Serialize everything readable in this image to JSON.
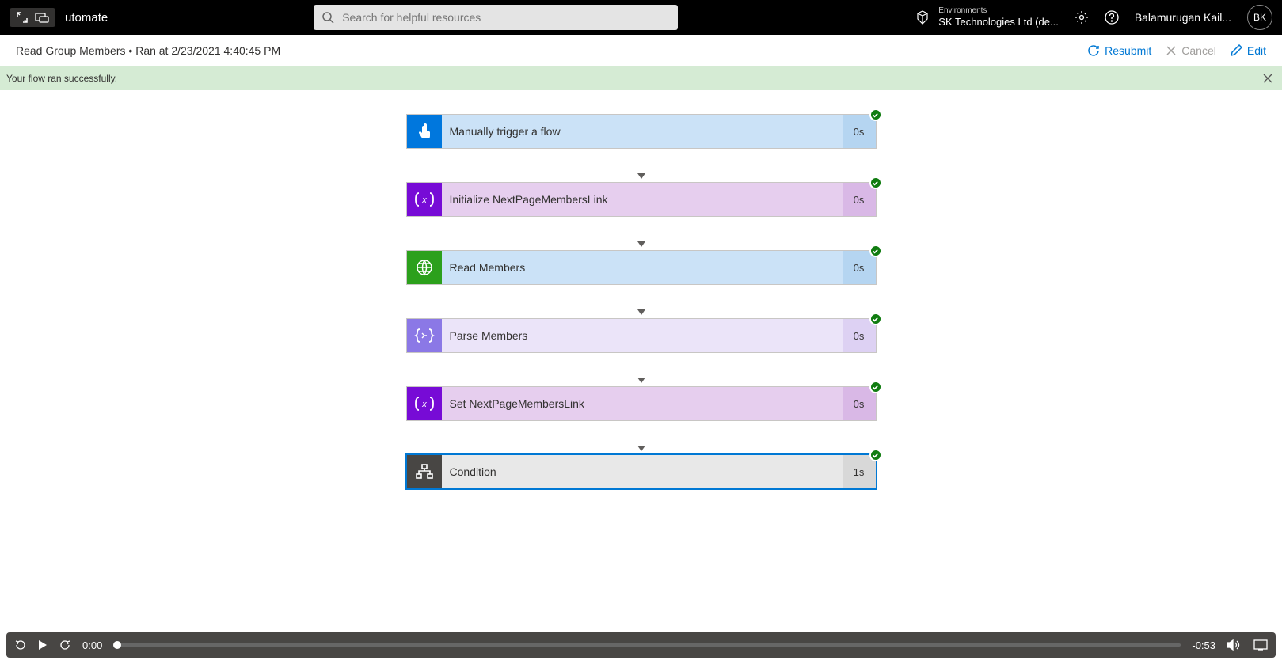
{
  "header": {
    "app_name": "utomate",
    "search_placeholder": "Search for helpful resources",
    "env_label": "Environments",
    "env_name": "SK Technologies Ltd (de...",
    "user_name": "Balamurugan Kail...",
    "user_initials": "BK"
  },
  "subheader": {
    "flow_name": "Read Group Members",
    "run_info": "Ran at 2/23/2021 4:40:45 PM",
    "resubmit": "Resubmit",
    "cancel": "Cancel",
    "edit": "Edit"
  },
  "banner": {
    "message": "Your flow ran successfully."
  },
  "steps": [
    {
      "title": "Manually trigger a flow",
      "time": "0s",
      "icon": "touch",
      "icon_bg": "c-blue-icon",
      "body_bg": "c-blue-body",
      "time_bg": "c-blue-time",
      "selected": false,
      "has_time": true
    },
    {
      "title": "Initialize NextPageMembersLink",
      "time": "0s",
      "icon": "var",
      "icon_bg": "c-purple-icon",
      "body_bg": "c-purple-body",
      "time_bg": "c-purple-time",
      "selected": false,
      "has_time": true
    },
    {
      "title": "Read Members",
      "time": "0s",
      "icon": "globe",
      "icon_bg": "c-green-icon",
      "body_bg": "c-blue-body",
      "time_bg": "c-blue-time",
      "selected": false,
      "has_time": true
    },
    {
      "title": "Parse Members",
      "time": "0s",
      "icon": "json",
      "icon_bg": "c-lilac-icon",
      "body_bg": "c-lilac-body",
      "time_bg": "c-lilac-time",
      "selected": false,
      "has_time": true
    },
    {
      "title": "Set NextPageMembersLink",
      "time": "0s",
      "icon": "var",
      "icon_bg": "c-purple-icon",
      "body_bg": "c-purple-body",
      "time_bg": "c-purple-time",
      "selected": false,
      "has_time": true
    },
    {
      "title": "Condition",
      "time": "1s",
      "icon": "cond",
      "icon_bg": "c-dark-icon",
      "body_bg": "c-grey-body",
      "time_bg": "c-grey-time",
      "selected": true,
      "has_time": true
    }
  ],
  "player": {
    "current": "0:00",
    "remaining": "-0:53"
  }
}
